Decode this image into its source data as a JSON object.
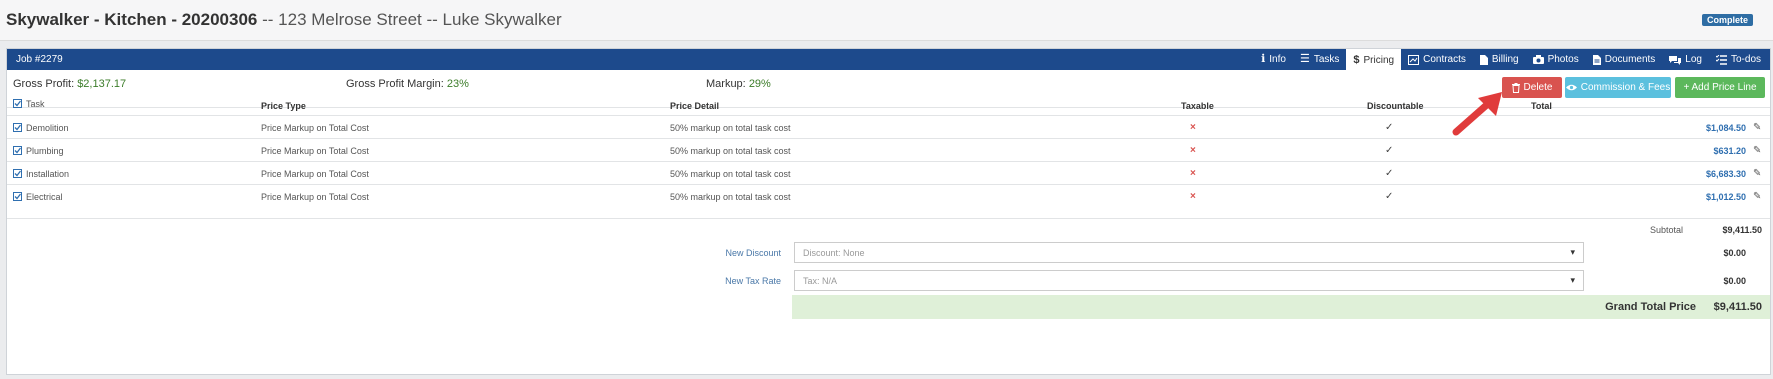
{
  "header": {
    "title_bold": "Skywalker - Kitchen - 20200306",
    "title_rest": "-- 123 Melrose Street -- Luke Skywalker",
    "status": "Complete"
  },
  "job": {
    "number": "Job #2279",
    "tabs": [
      {
        "label": "Info",
        "icon": "info-icon"
      },
      {
        "label": "Tasks",
        "icon": "list-icon"
      },
      {
        "label": "Pricing",
        "icon": "dollar-icon",
        "active": true
      },
      {
        "label": "Contracts",
        "icon": "contract-icon"
      },
      {
        "label": "Billing",
        "icon": "file-icon"
      },
      {
        "label": "Photos",
        "icon": "camera-icon"
      },
      {
        "label": "Documents",
        "icon": "document-icon"
      },
      {
        "label": "Log",
        "icon": "chat-icon"
      },
      {
        "label": "To-dos",
        "icon": "checklist-icon"
      }
    ]
  },
  "summary": {
    "gross_profit_label": "Gross Profit:",
    "gross_profit_value": "$2,137.17",
    "margin_label": "Gross Profit Margin:",
    "margin_value": "23%",
    "markup_label": "Markup:",
    "markup_value": "29%"
  },
  "actions": {
    "delete": "Delete",
    "commission": "Commission & Fees",
    "add": "+ Add Price Line"
  },
  "table": {
    "columns": {
      "task": "Task",
      "price_type": "Price Type",
      "price_detail": "Price Detail",
      "taxable": "Taxable",
      "discountable": "Discountable",
      "total": "Total"
    },
    "rows": [
      {
        "task": "Demolition",
        "price_type": "Price Markup on Total Cost",
        "price_detail": "50% markup on total task cost",
        "taxable": false,
        "discountable": true,
        "total": "$1,084.50"
      },
      {
        "task": "Plumbing",
        "price_type": "Price Markup on Total Cost",
        "price_detail": "50% markup on total task cost",
        "taxable": false,
        "discountable": true,
        "total": "$631.20"
      },
      {
        "task": "Installation",
        "price_type": "Price Markup on Total Cost",
        "price_detail": "50% markup on total task cost",
        "taxable": false,
        "discountable": true,
        "total": "$6,683.30"
      },
      {
        "task": "Electrical",
        "price_type": "Price Markup on Total Cost",
        "price_detail": "50% markup on total task cost",
        "taxable": false,
        "discountable": true,
        "total": "$1,012.50"
      }
    ]
  },
  "totals": {
    "subtotal_label": "Subtotal",
    "subtotal_value": "$9,411.50",
    "discount_label": "New Discount",
    "discount_placeholder": "Discount: None",
    "discount_value": "$0.00",
    "tax_label": "New Tax Rate",
    "tax_placeholder": "Tax: N/A",
    "tax_value": "$0.00",
    "grand_label": "Grand Total Price",
    "grand_value": "$9,411.50"
  },
  "colors": {
    "header_blue": "#1d4a8c",
    "delete_red": "#d9534f",
    "commission_cyan": "#5bc0de",
    "add_green": "#5cb85c",
    "grand_bg": "#dff0d8"
  }
}
